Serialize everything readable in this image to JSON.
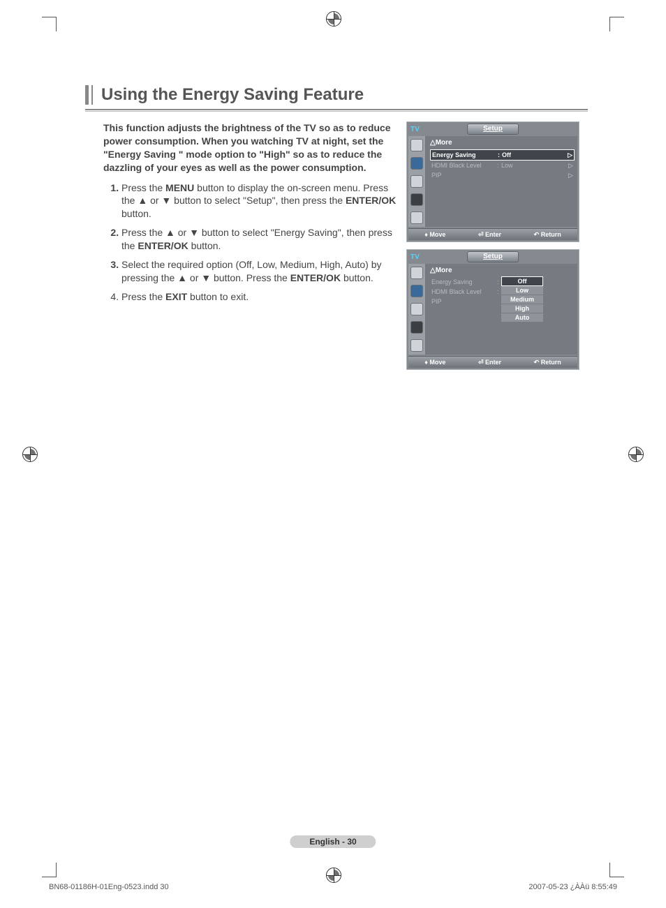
{
  "title": "Using the Energy Saving Feature",
  "intro": "This function adjusts the brightness of the TV so as to reduce power consumption. When you watching TV at night, set the \"Energy Saving \" mode option to \"High\" so as to reduce the dazzling of your eyes as well as the power consumption.",
  "steps": {
    "s1a": "Press the ",
    "s1_menu": "MENU",
    "s1b": " button to display the on-screen menu. Press the ▲ or ▼ button to select \"Setup\", then press the ",
    "s1_enter": "ENTER/OK",
    "s1c": " button.",
    "s2a": "Press the ▲ or ▼ button to select \"Energy Saving\", then press the ",
    "s2_enter": "ENTER/OK",
    "s2b": " button.",
    "s3a": "Select the required option (Off, Low, Medium, High, Auto) by pressing the ▲ or ▼ button. Press the ",
    "s3_enter": "ENTER/OK",
    "s3b": " button.",
    "s4a": "Press the ",
    "s4_exit": "EXIT",
    "s4b": " button to exit."
  },
  "osd": {
    "tv": "TV",
    "title": "Setup",
    "more": "△More",
    "rows": {
      "energy_label": "Energy Saving",
      "energy_value": "Off",
      "hdmi_label": "HDMI Black Level",
      "hdmi_value": "Low",
      "pip_label": "PIP"
    },
    "options": {
      "off": "Off",
      "low": "Low",
      "medium": "Medium",
      "high": "High",
      "auto": "Auto"
    },
    "footer": {
      "move": "Move",
      "enter": "Enter",
      "return": "Return"
    }
  },
  "page_footer": "English - 30",
  "imprint_left": "BN68-01186H-01Eng-0523.indd   30",
  "imprint_right": "2007-05-23   ¿ÀÀü 8:55:49"
}
